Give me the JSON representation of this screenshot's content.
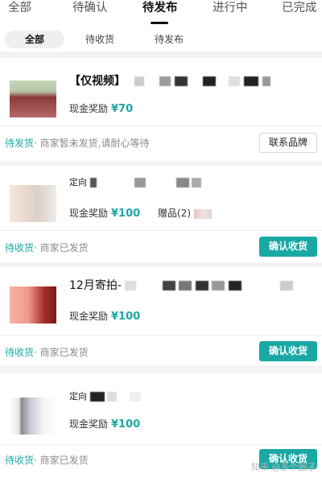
{
  "top_tabs": [
    {
      "label": "全部"
    },
    {
      "label": "待确认"
    },
    {
      "label": "待发布"
    },
    {
      "label": "进行中"
    },
    {
      "label": "已完成"
    }
  ],
  "sub_tabs": [
    {
      "label": "全部"
    },
    {
      "label": "待收货"
    },
    {
      "label": "待发布"
    }
  ],
  "orders": [
    {
      "title": "【仅视频】",
      "reward_label": "现金奖励",
      "reward_amount": "¥70",
      "status": "待发货",
      "status_note": "· 商家暂未发货,请耐心等待",
      "button": "联系品牌"
    },
    {
      "title": "定向",
      "reward_label": "现金奖励",
      "reward_amount": "¥100",
      "gift_label": "赠品(2)",
      "status": "待收货",
      "status_note": "· 商家已发货",
      "button": "确认收货"
    },
    {
      "title": "12月寄拍-",
      "reward_label": "现金奖励",
      "reward_amount": "¥100",
      "status": "待收货",
      "status_note": "· 商家已发货",
      "button": "确认收货"
    },
    {
      "title": "定向",
      "reward_label": "现金奖励",
      "reward_amount": "¥100",
      "status": "待收货",
      "status_note": "· 商家已发货",
      "button": "确认收货"
    }
  ],
  "watermark": "知乎 @多个圈子",
  "colors": {
    "accent": "#1aa8a5",
    "background": "#f3f3f4"
  }
}
